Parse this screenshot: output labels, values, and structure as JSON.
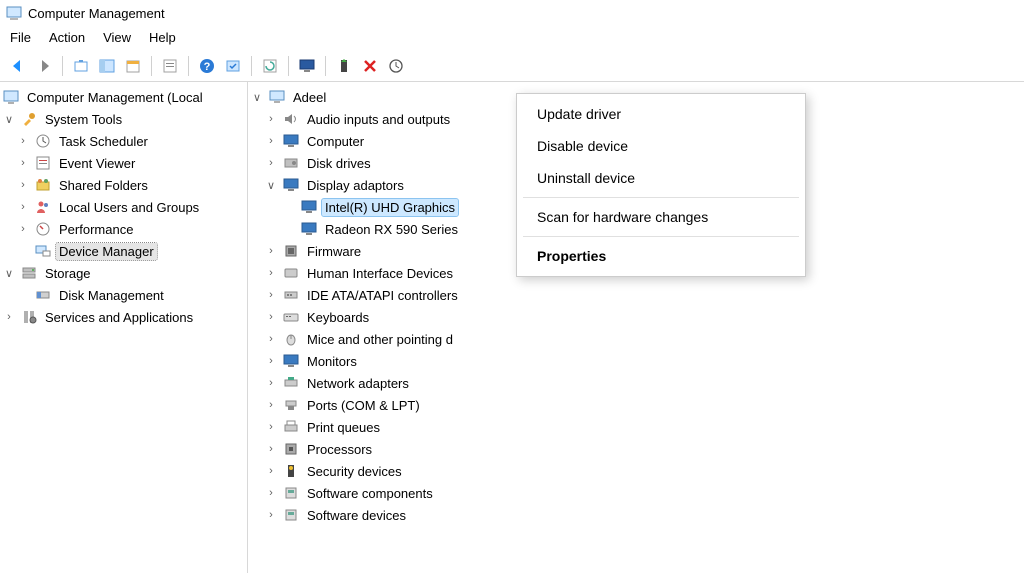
{
  "window": {
    "title": "Computer Management"
  },
  "menubar": {
    "file": "File",
    "action": "Action",
    "view": "View",
    "help": "Help"
  },
  "left_tree": {
    "root": "Computer Management (Local",
    "system_tools": "System Tools",
    "task_scheduler": "Task Scheduler",
    "event_viewer": "Event Viewer",
    "shared_folders": "Shared Folders",
    "local_users": "Local Users and Groups",
    "performance": "Performance",
    "device_manager": "Device Manager",
    "storage": "Storage",
    "disk_management": "Disk Management",
    "services": "Services and Applications"
  },
  "right_tree": {
    "root": "Adeel",
    "audio": "Audio inputs and outputs",
    "computer": "Computer",
    "disk": "Disk drives",
    "display": "Display adaptors",
    "gpu1": "Intel(R) UHD Graphics",
    "gpu2": "Radeon RX 590 Series",
    "firmware": "Firmware",
    "hid": "Human Interface Devices",
    "ide": "IDE ATA/ATAPI controllers",
    "keyboards": "Keyboards",
    "mice": "Mice and other pointing d",
    "monitors": "Monitors",
    "network": "Network adapters",
    "ports": "Ports (COM & LPT)",
    "print": "Print queues",
    "processors": "Processors",
    "security": "Security devices",
    "sw_components": "Software components",
    "sw_devices": "Software devices"
  },
  "context": {
    "update": "Update driver",
    "disable": "Disable device",
    "uninstall": "Uninstall device",
    "scan": "Scan for hardware changes",
    "properties": "Properties"
  }
}
